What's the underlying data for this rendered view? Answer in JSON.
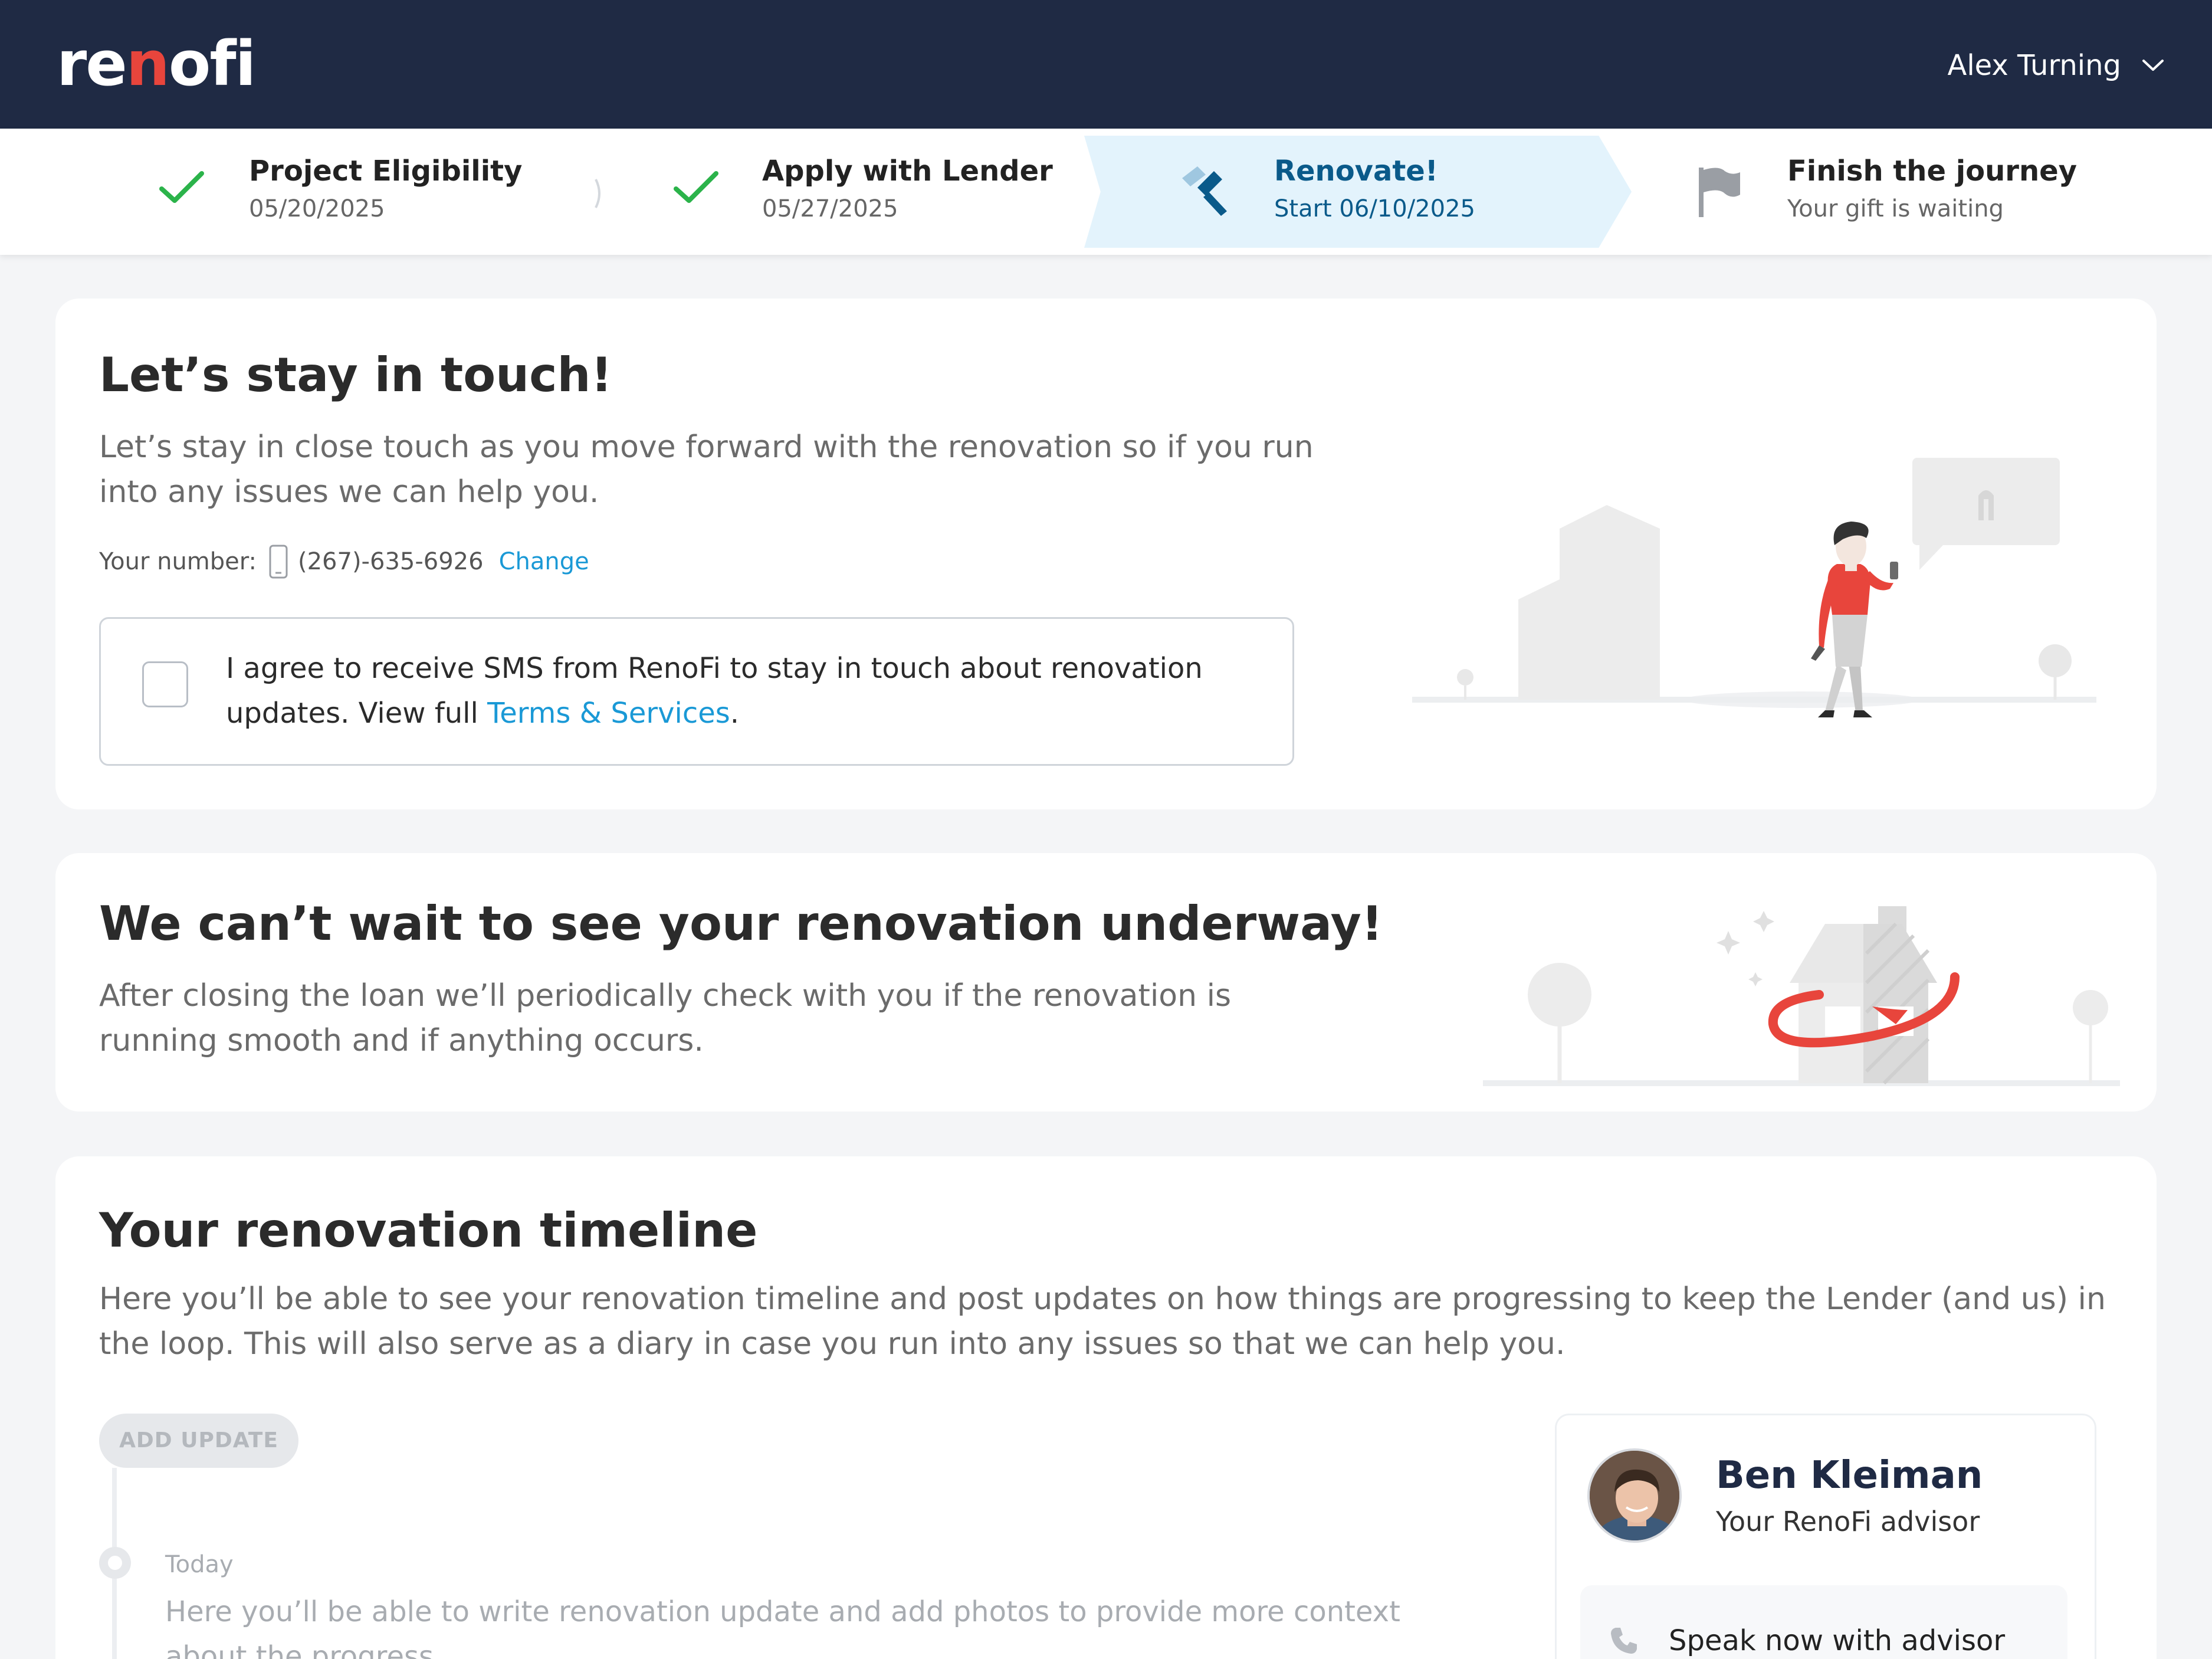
{
  "header": {
    "logo": {
      "part1": "re",
      "part2": "n",
      "part3": "ofi"
    },
    "user_name": "Alex Turning"
  },
  "stepper": {
    "steps": [
      {
        "title": "Project Eligibility",
        "subtitle": "05/20/2025",
        "status": "done"
      },
      {
        "title": "Apply with Lender",
        "subtitle": "05/27/2025",
        "status": "done"
      },
      {
        "title": "Renovate!",
        "subtitle": "Start 06/10/2025",
        "status": "active"
      },
      {
        "title": "Finish the journey",
        "subtitle": "Your gift is waiting",
        "status": "upcoming"
      }
    ]
  },
  "stay_in_touch": {
    "title": "Let’s stay in touch!",
    "description": "Let’s stay in close touch as you move forward with the renovation so if you run into any issues we can help you.",
    "number_label": "Your number:",
    "phone_number": "(267)-635-6926",
    "change_link": "Change",
    "agree_text_before": "I agree to receive SMS from RenoFi to stay in touch about renovation updates. View full ",
    "agree_link": "Terms & Services",
    "agree_text_after": "."
  },
  "underway": {
    "title": "We can’t wait to see your renovation underway!",
    "description": "After closing the loan we’ll periodically check with you if the renovation is running smooth and if anything occurs."
  },
  "timeline": {
    "title": "Your renovation timeline",
    "description": "Here you’ll be able to see your renovation timeline and post updates on how things are progressing to keep the Lender (and us) in the loop. This will also serve as a diary in case you run into any issues so that we can help you.",
    "add_button": "ADD UPDATE",
    "entry_date": "Today",
    "entry_text": "Here you’ll be able to write renovation update and add photos to provide more context about the progress."
  },
  "advisor": {
    "name": "Ben Kleiman",
    "role": "Your RenoFi advisor",
    "speak_label": "Speak now with advisor"
  },
  "colors": {
    "header_bg": "#1f2a44",
    "accent_red": "#e8453c",
    "link_blue": "#1a99d6",
    "check_green": "#2bb34a",
    "active_step_bg": "#e3f3fc"
  }
}
